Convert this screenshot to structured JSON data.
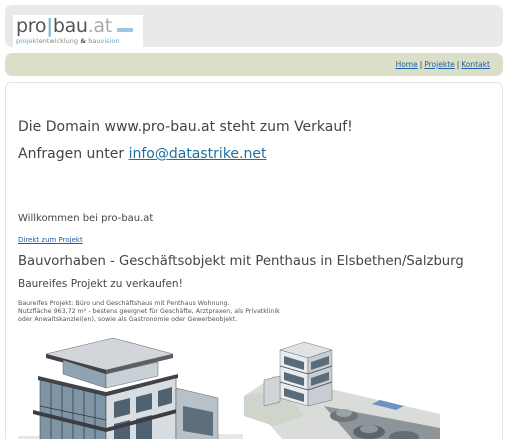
{
  "logo": {
    "brand_pro": "pro",
    "brand_sep": "|",
    "brand_bau": "bau",
    "brand_ext": ".at",
    "tag_projekt": "projekt",
    "tag_entwicklung": "entwicklung",
    "tag_amp": " & ",
    "tag_bau": "bau",
    "tag_vision": "vision"
  },
  "nav": {
    "items": [
      {
        "label": "Home"
      },
      {
        "label": "Projekte"
      },
      {
        "label": "Kontakt"
      }
    ],
    "separator": "|"
  },
  "sale": {
    "line1": "Die Domain www.pro-bau.at steht zum Verkauf!",
    "line2_prefix": "Anfragen unter ",
    "email": "info@datastrike.net"
  },
  "welcome": "Willkommen bei pro-bau.at",
  "direct_link": "Direkt zum Projekt",
  "project": {
    "title": "Bauvorhaben - Geschäftsobjekt mit Penthaus in Elsbethen/Salzburg",
    "subtitle": "Baureifes Projekt zu verkaufen!",
    "description_lines": [
      "Baureifes Projekt: Büro und Geschäftshaus mit Penthaus Wohnung.",
      "Nutzfläche 963,72 m² - bestens geeignet für Geschäfte, Arztpraxen, als Privatklinik",
      "oder Anwaltskanzlei(en), sowie als Gastronomie oder Gewerbeobjekt."
    ]
  },
  "colors": {
    "header_bg": "#e9e9e9",
    "nav_bg": "#dcdfc8",
    "link": "#1f5fa8",
    "logo_accent": "#7fb3cf"
  },
  "images": {
    "render_left": "building-render-icon",
    "render_right": "building-render-icon"
  }
}
